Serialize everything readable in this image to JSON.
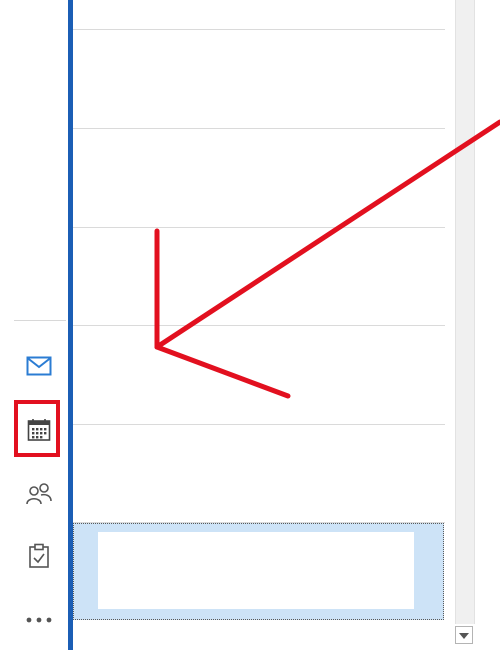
{
  "navigation": {
    "items": [
      {
        "id": "mail",
        "icon": "mail-icon",
        "color": "#2b7cd3"
      },
      {
        "id": "calendar",
        "icon": "calendar-icon",
        "color": "#444444",
        "highlighted": true
      },
      {
        "id": "people",
        "icon": "people-icon",
        "color": "#555555"
      },
      {
        "id": "tasks",
        "icon": "tasks-icon",
        "color": "#555555"
      },
      {
        "id": "more",
        "icon": "more-icon",
        "color": "#555555"
      }
    ]
  },
  "calendar": {
    "accent_color": "#1b5eb5",
    "selection_color": "#cde3f7"
  },
  "annotation": {
    "arrow_color": "#e2101f",
    "highlight_color": "#e2101f"
  }
}
